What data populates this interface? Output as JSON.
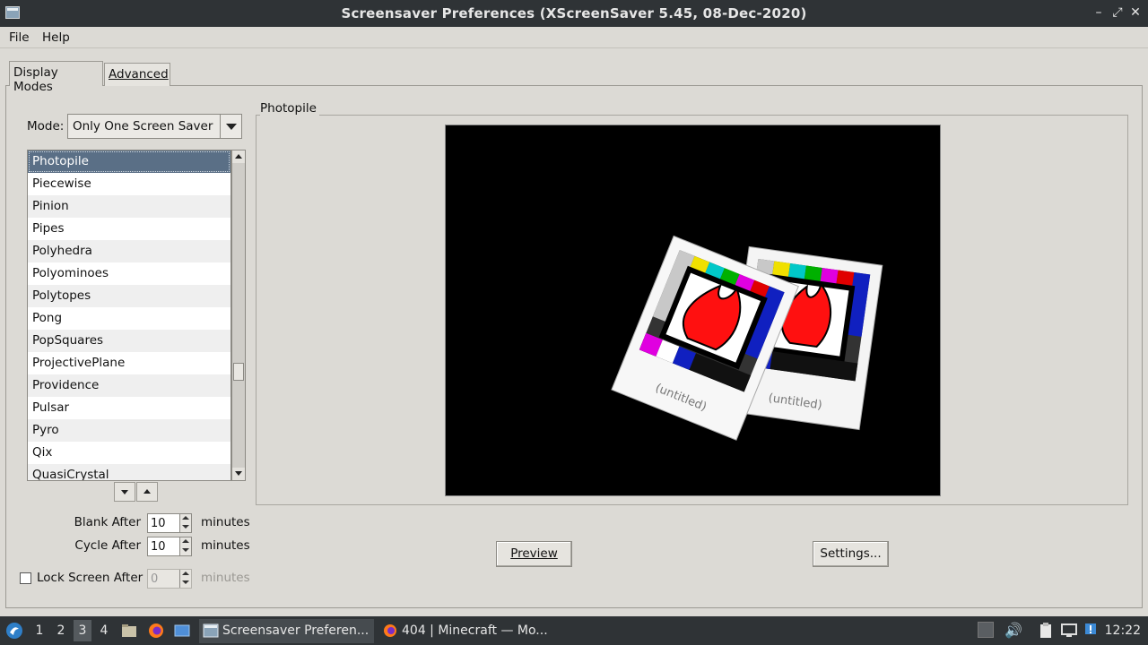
{
  "window": {
    "title": "Screensaver Preferences  (XScreenSaver 5.45, 08-Dec-2020)"
  },
  "menu": {
    "file": "File",
    "help": "Help"
  },
  "tabs": {
    "display_modes": "Display Modes",
    "advanced": "Advanced"
  },
  "mode": {
    "label": "Mode:",
    "value": "Only One Screen Saver"
  },
  "list": {
    "items": [
      "Photopile",
      "Piecewise",
      "Pinion",
      "Pipes",
      "Polyhedra",
      "Polyominoes",
      "Polytopes",
      "Pong",
      "PopSquares",
      "ProjectivePlane",
      "Providence",
      "Pulsar",
      "Pyro",
      "Qix",
      "QuasiCrystal"
    ],
    "selected_index": 0
  },
  "blank_after": {
    "label": "Blank After",
    "value": "10",
    "unit": "minutes"
  },
  "cycle_after": {
    "label": "Cycle After",
    "value": "10",
    "unit": "minutes"
  },
  "lock_after": {
    "label": "Lock Screen After",
    "value": "0",
    "unit": "minutes",
    "checked": false
  },
  "preview_frame": {
    "title": "Photopile",
    "photo_caption": "(untitled)"
  },
  "buttons": {
    "preview": "Preview",
    "settings": "Settings..."
  },
  "taskbar": {
    "workspaces": [
      "1",
      "2",
      "3",
      "4"
    ],
    "active_workspace": "3",
    "tasks": [
      {
        "label": "Screensaver Preferen...",
        "icon": "window-icon"
      },
      {
        "label": "404 | Minecraft — Mo...",
        "icon": "firefox-icon"
      }
    ],
    "clock": "12:22"
  }
}
